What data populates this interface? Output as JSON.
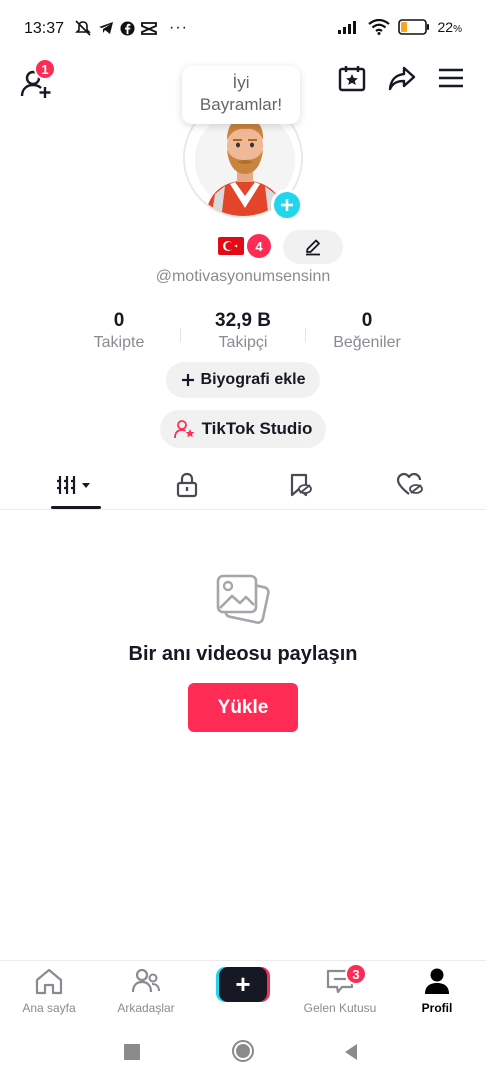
{
  "status_bar": {
    "time": "13:37",
    "more": "···",
    "battery_pct": "22"
  },
  "header": {
    "friend_requests_count": "1"
  },
  "avatar": {
    "speech_bubble_line1": "İyi",
    "speech_bubble_line2": "Bayramlar!"
  },
  "profile": {
    "country": "Türkiye",
    "notification_count": "4",
    "username": "@motivasyonumsensinn"
  },
  "stats": [
    {
      "value": "0",
      "label": "Takipte"
    },
    {
      "value": "32,9 B",
      "label": "Takipçi"
    },
    {
      "value": "0",
      "label": "Beğeniler"
    }
  ],
  "buttons": {
    "add_bio": "Biyografi ekle",
    "studio": "TikTok Studio"
  },
  "tabs": [
    "videos",
    "private",
    "reposts",
    "liked"
  ],
  "empty_state": {
    "title": "Bir anı videosu paylaşın",
    "upload_label": "Yükle"
  },
  "bottom_nav": {
    "home": "Ana sayfa",
    "friends": "Arkadaşlar",
    "create": "+",
    "inbox": "Gelen Kutusu",
    "inbox_count": "3",
    "profile": "Profil"
  },
  "colors": {
    "accent": "#fe2c55",
    "cyan": "#20d5ec",
    "text": "#161823",
    "muted": "#8a8b91"
  }
}
